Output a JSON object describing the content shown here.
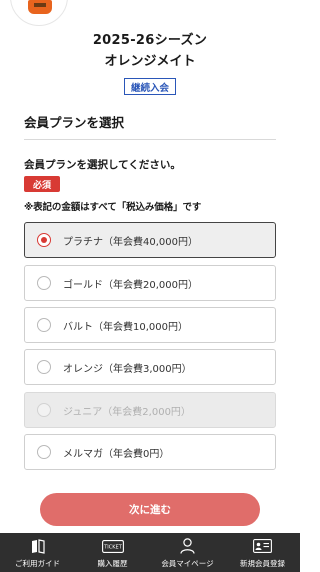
{
  "header": {
    "season": "2025-26シーズン",
    "member_type": "オレンジメイト",
    "renewal_badge": "継続入会"
  },
  "section": {
    "title": "会員プランを選択"
  },
  "form": {
    "instruction": "会員プランを選択してください。",
    "required_badge": "必須",
    "tax_note": "※表記の金額はすべて「税込み価格」です",
    "plans": [
      {
        "label": "プラチナ（年会費40,000円）",
        "selected": true,
        "disabled": false
      },
      {
        "label": "ゴールド（年会費20,000円）",
        "selected": false,
        "disabled": false
      },
      {
        "label": "バルト（年会費10,000円）",
        "selected": false,
        "disabled": false
      },
      {
        "label": "オレンジ（年会費3,000円）",
        "selected": false,
        "disabled": false
      },
      {
        "label": "ジュニア（年会費2,000円）",
        "selected": false,
        "disabled": true
      },
      {
        "label": "メルマガ（年会費0円）",
        "selected": false,
        "disabled": false
      }
    ],
    "next_button": "次に進む"
  },
  "tabbar": {
    "items": [
      {
        "label": "ご利用ガイド",
        "icon": "book-icon"
      },
      {
        "label": "購入履歴",
        "icon": "ticket-icon"
      },
      {
        "label": "会員マイページ",
        "icon": "person-icon"
      },
      {
        "label": "新規会員登録",
        "icon": "id-card-icon"
      }
    ],
    "ticket_icon_text": "TICKET"
  },
  "colors": {
    "accent_red": "#d83a34",
    "next_button": "#e06d6a",
    "badge_blue": "#2a56b8",
    "tabbar_bg": "#2f2f2f"
  }
}
